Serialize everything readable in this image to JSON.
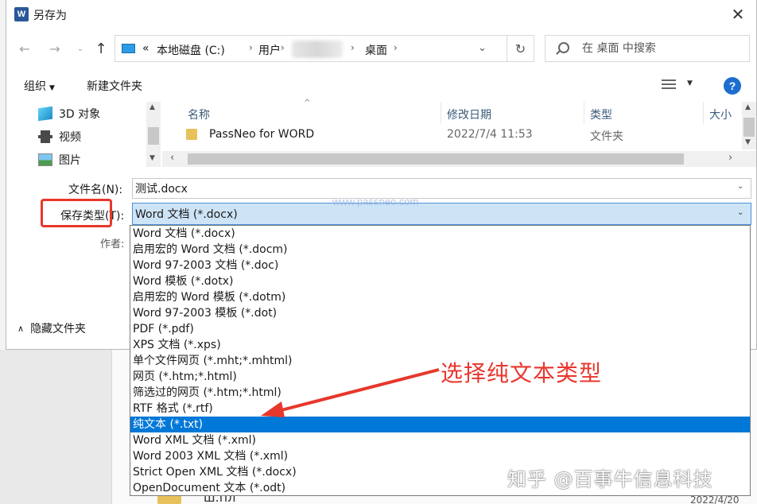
{
  "dialog": {
    "title": "另存为",
    "app_icon_letter": "W",
    "close_glyph": "✕"
  },
  "nav": {
    "back_glyph": "←",
    "forward_glyph": "→",
    "recent_glyph": "⌄",
    "up_glyph": "↑",
    "breadcrumb_prefix": "«",
    "breadcrumbs": [
      "本地磁盘 (C:)",
      "用户",
      "桌面"
    ],
    "crumb_sep": "›",
    "refresh_glyph": "↻",
    "dropdown_glyph": "⌄"
  },
  "search": {
    "placeholder": "在 桌面 中搜索"
  },
  "toolbar": {
    "organize_label": "组织",
    "organize_caret": "▼",
    "new_folder_label": "新建文件夹",
    "view_caret": "▼",
    "help_label": "?"
  },
  "nav_pane": {
    "items": [
      "3D 对象",
      "视频",
      "图片"
    ]
  },
  "file_list": {
    "columns": [
      "名称",
      "修改日期",
      "类型",
      "大小"
    ],
    "sort_caret": "^",
    "rows": [
      {
        "name": "PassNeo for WORD",
        "modified": "2022/7/4 11:53",
        "type": "文件夹"
      }
    ]
  },
  "form": {
    "filename_label": "文件名(N):",
    "filename_value": "测试.docx",
    "savetype_label": "保存类型(T):",
    "savetype_value": "Word 文档 (*.docx)",
    "author_label": "作者:",
    "hide_folders_label": "隐藏文件夹",
    "caret": "⌄"
  },
  "type_options": [
    "Word 文档 (*.docx)",
    "启用宏的 Word 文档 (*.docm)",
    "Word 97-2003 文档 (*.doc)",
    "Word 模板 (*.dotx)",
    "启用宏的 Word 模板 (*.dotm)",
    "Word 97-2003 模板 (*.dot)",
    "PDF (*.pdf)",
    "XPS 文档 (*.xps)",
    "单个文件网页 (*.mht;*.mhtml)",
    "网页 (*.htm;*.html)",
    "筛选过的网页 (*.htm;*.html)",
    "RTF 格式 (*.rtf)",
    "纯文本 (*.txt)",
    "Word XML 文档 (*.xml)",
    "Word 2003 XML 文档 (*.xml)",
    "Strict Open XML 文档 (*.docx)",
    "OpenDocument 文本 (*.odt)"
  ],
  "selected_type_index": 12,
  "watermark": "www.passneo.com",
  "annotation": "选择纯文本类型",
  "credit": "知乎 @百事牛信息科技",
  "background": {
    "fragment": "ш.пл",
    "date_fragment": "2022/4/20"
  },
  "colors": {
    "accent": "#0078d7",
    "annotation_red": "#e8372c",
    "select_bg": "#cde4f7"
  }
}
